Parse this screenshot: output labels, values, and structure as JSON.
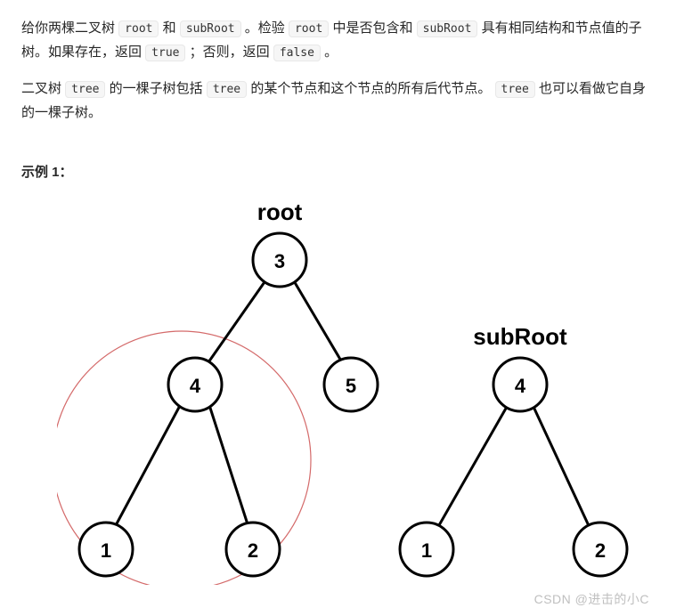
{
  "text": {
    "p1_s1": "给你两棵二叉树 ",
    "p1_c1": "root",
    "p1_s2": " 和 ",
    "p1_c2": "subRoot",
    "p1_s3": " 。检验 ",
    "p1_c3": "root",
    "p1_s4": " 中是否包含和 ",
    "p1_c4": "subRoot",
    "p1_s5": " 具有相同结构和节点值的子树。如果存在，返回 ",
    "p1_c5": "true",
    "p1_s6": " ；否则，返回 ",
    "p1_c6": "false",
    "p1_s7": " 。",
    "p2_s1": "二叉树 ",
    "p2_c1": "tree",
    "p2_s2": " 的一棵子树包括 ",
    "p2_c2": "tree",
    "p2_s3": " 的某个节点和这个节点的所有后代节点。",
    "p2_c3": "tree",
    "p2_s4": " 也可以看做它自身的一棵子树。",
    "example_label": "示例 1：",
    "watermark": "CSDN @进击的小C"
  },
  "diagram": {
    "root_label": "root",
    "subroot_label": "subRoot",
    "root_tree": {
      "value": "3",
      "left": {
        "value": "4",
        "left": {
          "value": "1"
        },
        "right": {
          "value": "2"
        }
      },
      "right": {
        "value": "5"
      }
    },
    "subroot_tree": {
      "value": "4",
      "left": {
        "value": "1"
      },
      "right": {
        "value": "2"
      }
    },
    "highlight_circle": true
  }
}
